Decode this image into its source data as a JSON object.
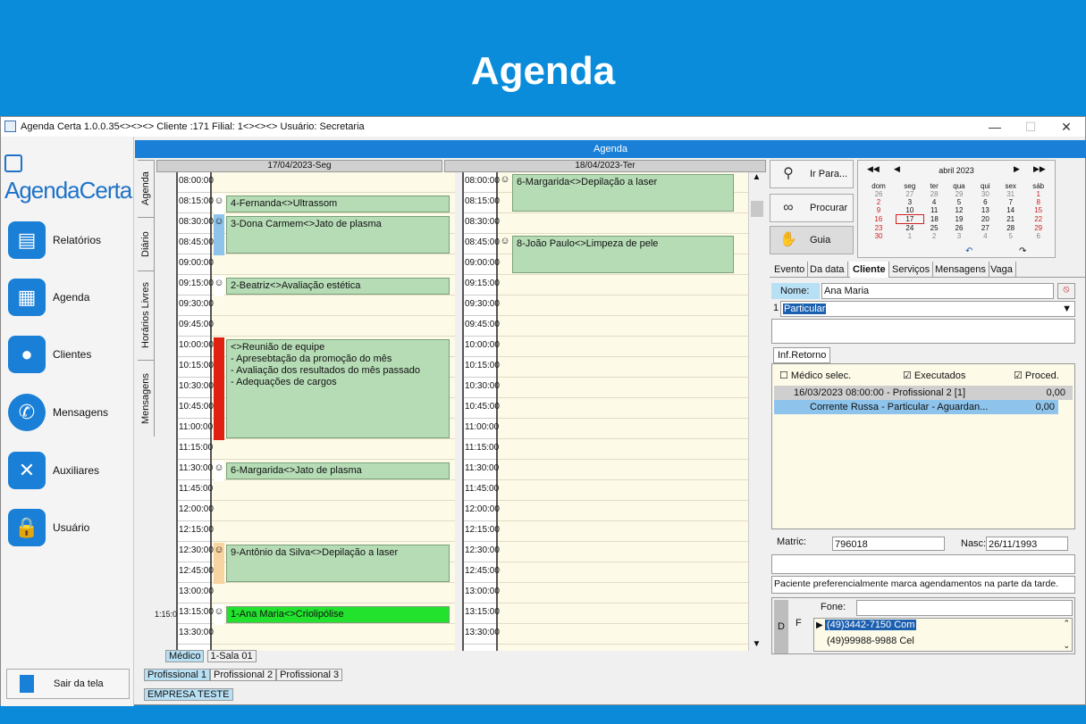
{
  "banner_title": "Agenda",
  "window": {
    "title": "Agenda Certa 1.0.0.35<><><> Cliente :171 Filial: 1<><><> Usuário: Secretaria",
    "minimize": "—",
    "maximize": "☐",
    "close": "✕"
  },
  "sidebar": {
    "logo": "AgendaCerta",
    "items": [
      {
        "label": "Relatórios",
        "icon": "chart-icon"
      },
      {
        "label": "Agenda",
        "icon": "calendar-icon"
      },
      {
        "label": "Clientes",
        "icon": "users-icon"
      },
      {
        "label": "Mensagens",
        "icon": "whatsapp-icon"
      },
      {
        "label": "Auxiliares",
        "icon": "tools-icon"
      },
      {
        "label": "Usuário",
        "icon": "lock-icon"
      }
    ],
    "exit": "Sair da tela"
  },
  "agenda_bar": "Agenda",
  "vtabs": [
    "Agenda",
    "Diário",
    "Horários Livres",
    "Mensagens"
  ],
  "days": [
    {
      "header": "17/04/2023-Seg"
    },
    {
      "header": "18/04/2023-Ter"
    }
  ],
  "times": [
    "08:00:00",
    "08:15:00",
    "08:30:00",
    "08:45:00",
    "09:00:00",
    "09:15:00",
    "09:30:00",
    "09:45:00",
    "10:00:00",
    "10:15:00",
    "10:30:00",
    "10:45:00",
    "11:00:00",
    "11:15:00",
    "11:30:00",
    "11:45:00",
    "12:00:00",
    "12:15:00",
    "12:30:00",
    "12:45:00",
    "13:00:00",
    "13:15:00",
    "13:30:00"
  ],
  "events_day1": [
    "4-Fernanda<>Ultrassom",
    "3-Dona Carmem<>Jato de plasma",
    "2-Beatriz<>Avaliação estética",
    "<>Reunião de equipe\n- Apresebtação da promoção do mês\n- Avaliação dos resultados do mês passado\n- Adequações de cargos",
    "6-Margarida<>Jato de plasma",
    "9-Antônio da Silva<>Depilação a laser",
    "1-Ana Maria<>Criolipólise"
  ],
  "events_day2": [
    "6-Margarida<>Depilação a laser",
    "8-João Paulo<>Limpeza de pele"
  ],
  "left_mini_time": "1:15:0",
  "medico_label": "Médico",
  "sala_label": "1-Sala 01",
  "prof_tabs": [
    "Profissional 1",
    "Profissional 2",
    "Profissional 3"
  ],
  "empresa": "EMPRESA TESTE",
  "buttons": {
    "ir_para": "Ir Para...",
    "procurar": "Procurar",
    "guia": "Guia"
  },
  "calendar": {
    "month": "abril 2023",
    "weekdays": [
      "dom",
      "seg",
      "ter",
      "qua",
      "qui",
      "sex",
      "sáb"
    ],
    "weeks": [
      [
        "26",
        "27",
        "28",
        "29",
        "30",
        "31",
        "1"
      ],
      [
        "2",
        "3",
        "4",
        "5",
        "6",
        "7",
        "8"
      ],
      [
        "9",
        "10",
        "11",
        "12",
        "13",
        "14",
        "15"
      ],
      [
        "16",
        "17",
        "18",
        "19",
        "20",
        "21",
        "22"
      ],
      [
        "23",
        "24",
        "25",
        "26",
        "27",
        "28",
        "29"
      ],
      [
        "30",
        "1",
        "2",
        "3",
        "4",
        "5",
        "6"
      ]
    ]
  },
  "client_tabs": [
    "Evento",
    "Da data",
    "Cliente",
    "Serviços",
    "Mensagens",
    "Vaga"
  ],
  "client": {
    "nome_label": "Nome:",
    "nome": "Ana Maria",
    "convenio_num": "1",
    "convenio": "Particular",
    "inf_retorno": "Inf.Retorno",
    "medico_selec": "Médico selec.",
    "executados": "Executados",
    "proced": "Proced.",
    "retorno_row": "16/03/2023 08:00:00 - Profissional 2 [1]",
    "retorno_val": "0,00",
    "retorno_sub": "Corrente Russa - Particular - Aguardan...",
    "retorno_sub_val": "0,00",
    "matric_label": "Matric:",
    "matric": "796018",
    "nasc_label": "Nasc:",
    "nasc": "26/11/1993",
    "obs": "Paciente preferencialmente marca agendamentos na parte da tarde.",
    "fone_label": "Fone:",
    "phones": [
      "(49)3442-7150 Com",
      "(49)99988-9988 Cel"
    ],
    "d": "D",
    "f": "F"
  }
}
